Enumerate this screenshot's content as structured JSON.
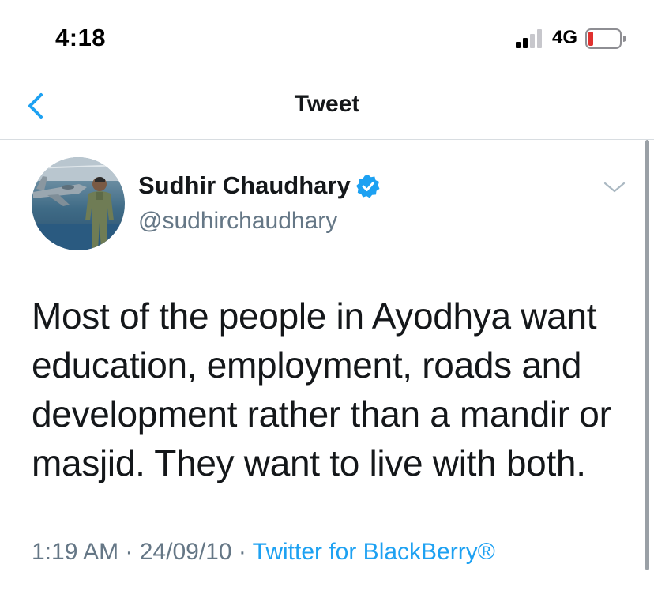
{
  "status_bar": {
    "time": "4:18",
    "network": "4G"
  },
  "nav": {
    "title": "Tweet"
  },
  "tweet": {
    "author_name": "Sudhir Chaudhary",
    "author_handle": "@sudhirchaudhary",
    "text": "Most of the people in Ayodhya want education, employment, roads and development rather than a mandir or masjid. They want to live with both.",
    "time": "1:19 AM",
    "sep1": " · ",
    "date": "24/09/10",
    "sep2": " · ",
    "source": "Twitter for BlackBerry®"
  },
  "colors": {
    "accent": "#1da1f2",
    "secondary_text": "#657786",
    "primary_text": "#14171a",
    "battery_low": "#e0312f"
  },
  "icons": {
    "back": "chevron-left-icon",
    "verified": "verified-badge-icon",
    "caret": "chevron-down-icon"
  }
}
